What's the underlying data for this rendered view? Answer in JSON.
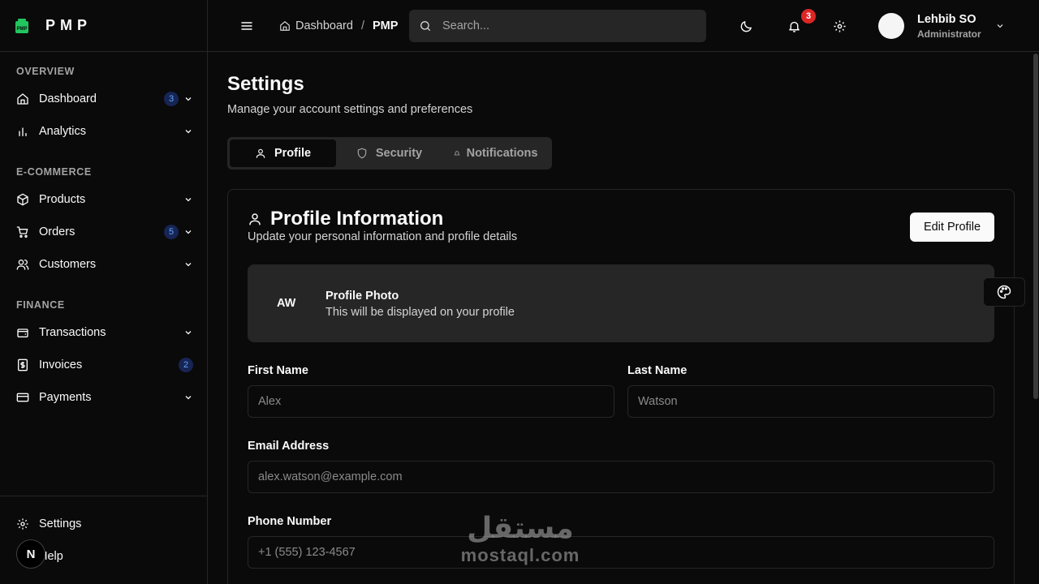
{
  "brand": {
    "name": "PMP",
    "logo_text": "PMP",
    "accent": "#22c55e"
  },
  "sidebar": {
    "sections": [
      {
        "title": "OVERVIEW"
      },
      {
        "title": "E-COMMERCE"
      },
      {
        "title": "FINANCE"
      }
    ],
    "items": [
      {
        "label": "Dashboard",
        "icon": "home-icon",
        "badge": "3",
        "has_chevron": true
      },
      {
        "label": "Analytics",
        "icon": "bar-chart-icon",
        "has_chevron": true
      },
      {
        "label": "Products",
        "icon": "package-icon",
        "has_chevron": true
      },
      {
        "label": "Orders",
        "icon": "cart-icon",
        "badge": "5",
        "has_chevron": true
      },
      {
        "label": "Customers",
        "icon": "users-icon",
        "has_chevron": true
      },
      {
        "label": "Transactions",
        "icon": "wallet-icon",
        "has_chevron": true
      },
      {
        "label": "Invoices",
        "icon": "receipt-icon",
        "badge": "2"
      },
      {
        "label": "Payments",
        "icon": "credit-card-icon",
        "has_chevron": true
      }
    ],
    "footer": [
      {
        "label": "Settings",
        "icon": "gear-icon"
      },
      {
        "label": "Help",
        "icon": "help-icon"
      }
    ],
    "n_badge": "N"
  },
  "header": {
    "breadcrumb": [
      "Dashboard",
      "PMP"
    ],
    "breadcrumb_separator": "/",
    "search_placeholder": "Search...",
    "notification_count": "3",
    "user": {
      "name": "Lehbib SO",
      "role": "Administrator"
    }
  },
  "page": {
    "title": "Settings",
    "subtitle": "Manage your account settings and preferences",
    "tabs": [
      {
        "label": "Profile",
        "active": true
      },
      {
        "label": "Security"
      },
      {
        "label": "Notifications"
      }
    ]
  },
  "profile_card": {
    "title": "Profile Information",
    "subtitle": "Update your personal information and profile details",
    "edit_button": "Edit Profile",
    "photo": {
      "initials": "AW",
      "title": "Profile Photo",
      "subtitle": "This will be displayed on your profile"
    },
    "fields": {
      "first_name": {
        "label": "First Name",
        "placeholder": "Alex"
      },
      "last_name": {
        "label": "Last Name",
        "placeholder": "Watson"
      },
      "email": {
        "label": "Email Address",
        "placeholder": "alex.watson@example.com"
      },
      "phone": {
        "label": "Phone Number",
        "placeholder": "+1 (555) 123-4567"
      }
    }
  },
  "watermark": {
    "arabic": "مستقل",
    "latin": "mostaql.com"
  }
}
